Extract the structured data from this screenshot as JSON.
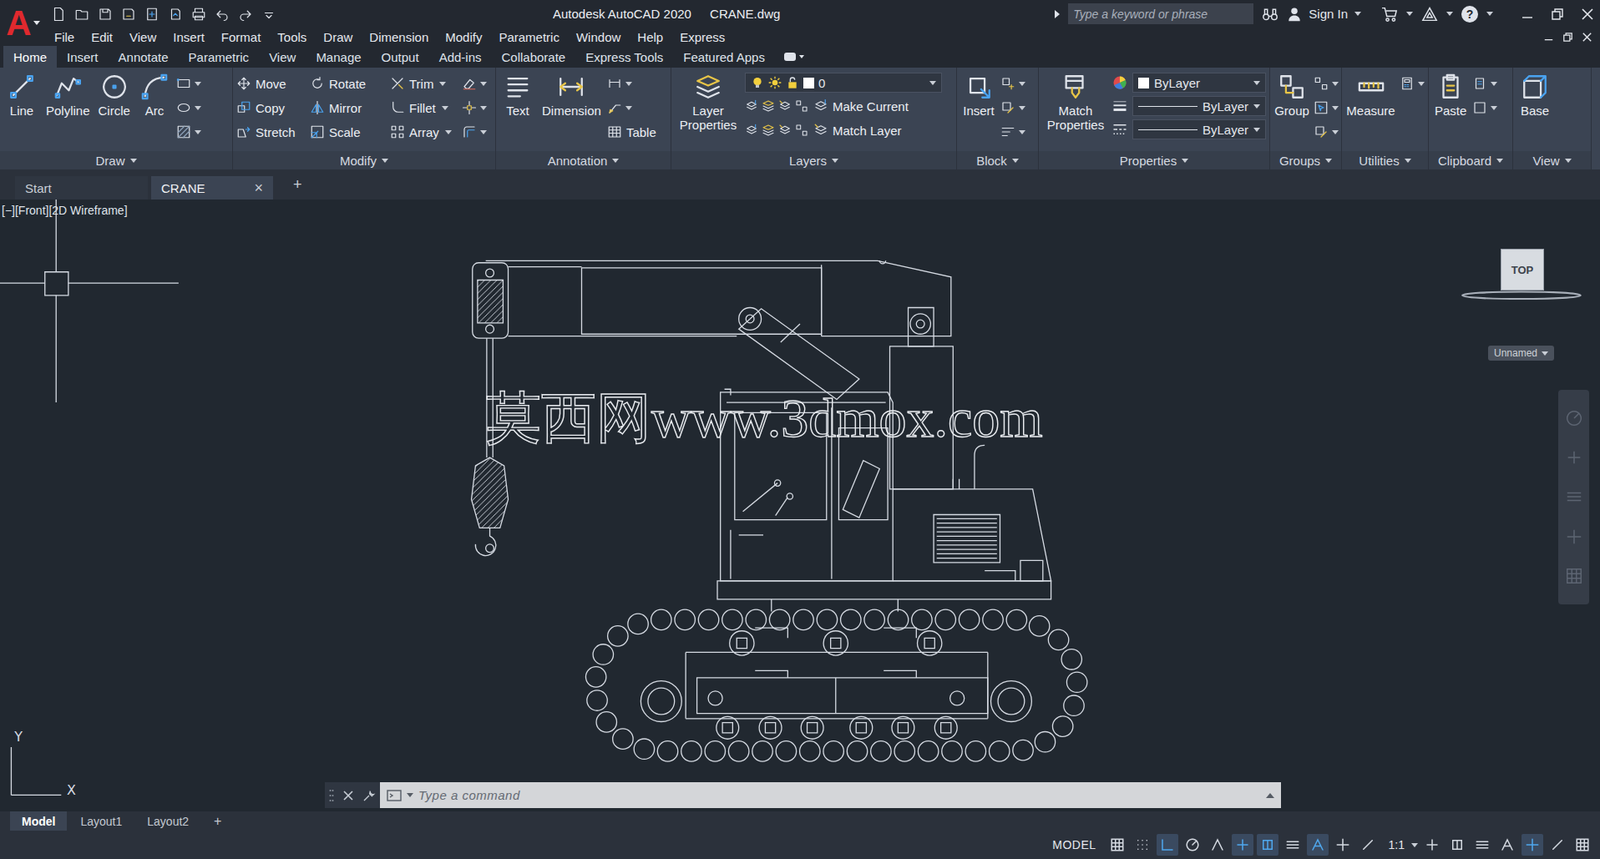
{
  "window": {
    "title": "Autodesk AutoCAD 2020",
    "file": "CRANE.dwg",
    "logo": "A"
  },
  "search": {
    "placeholder": "Type a keyword or phrase"
  },
  "account": {
    "label": "Sign In"
  },
  "help": "?",
  "menu": [
    "File",
    "Edit",
    "View",
    "Insert",
    "Format",
    "Tools",
    "Draw",
    "Dimension",
    "Modify",
    "Parametric",
    "Window",
    "Help",
    "Express"
  ],
  "ribbon_tabs": [
    {
      "label": "Home",
      "selected": true
    },
    {
      "label": "Insert",
      "selected": false
    },
    {
      "label": "Annotate",
      "selected": false
    },
    {
      "label": "Parametric",
      "selected": false
    },
    {
      "label": "View",
      "selected": false
    },
    {
      "label": "Manage",
      "selected": false
    },
    {
      "label": "Output",
      "selected": false
    },
    {
      "label": "Add-ins",
      "selected": false
    },
    {
      "label": "Collaborate",
      "selected": false
    },
    {
      "label": "Express Tools",
      "selected": false
    },
    {
      "label": "Featured Apps",
      "selected": false
    }
  ],
  "ribbon_panels": [
    {
      "title": "Draw",
      "large": [
        "Line",
        "Polyline",
        "Circle",
        "Arc"
      ],
      "small": []
    },
    {
      "title": "Modify",
      "large": [],
      "small": [
        "Move",
        "Rotate",
        "Trim",
        "Copy",
        "Mirror",
        "Fillet",
        "Stretch",
        "Scale",
        "Array"
      ]
    },
    {
      "title": "Annotation",
      "large": [
        "Text",
        "Dimension"
      ],
      "small": [
        "Table"
      ]
    },
    {
      "title": "Layers",
      "large": [
        "Layer Properties"
      ],
      "layer": "0",
      "small": [
        "Make Current",
        "Match Layer"
      ]
    },
    {
      "title": "Block",
      "large": [
        "Insert"
      ],
      "small": []
    },
    {
      "title": "Properties",
      "large": [
        "Match Properties"
      ],
      "dropdowns": [
        "ByLayer",
        "ByLayer",
        "ByLayer"
      ],
      "small": []
    },
    {
      "title": "Groups",
      "large": [
        "Group"
      ],
      "small": []
    },
    {
      "title": "Utilities",
      "large": [
        "Measure"
      ],
      "small": []
    },
    {
      "title": "Clipboard",
      "large": [
        "Paste"
      ],
      "small": []
    },
    {
      "title": "View",
      "large": [
        "Base"
      ],
      "small": []
    }
  ],
  "doc_tabs": [
    {
      "label": "Start",
      "selected": false,
      "closable": false
    },
    {
      "label": "CRANE",
      "selected": true,
      "closable": true
    }
  ],
  "doc_tab_close": "×",
  "doc_tab_add": "+",
  "viewport": {
    "label": "[−][Front][2D Wireframe]",
    "watermark": "莫西网www.3dmox.com",
    "viewcube": "TOP",
    "named_view": "Unnamed",
    "ucs_x": "X",
    "ucs_y": "Y"
  },
  "command": {
    "placeholder": "Type a command"
  },
  "layout_tabs": [
    {
      "label": "Model",
      "selected": true
    },
    {
      "label": "Layout1",
      "selected": false
    },
    {
      "label": "Layout2",
      "selected": false
    }
  ],
  "layout_add": "+",
  "status_bar": {
    "mode": "MODEL",
    "scale": "1:1",
    "toggles": [
      {
        "on": false
      },
      {
        "on": false
      },
      {
        "on": true
      },
      {
        "on": false
      },
      {
        "on": false
      },
      {
        "on": true
      },
      {
        "on": true
      },
      {
        "on": false
      },
      {
        "on": true
      },
      {
        "on": false
      },
      {
        "on": false
      }
    ],
    "tools": [
      {
        "on": false
      },
      {
        "on": false
      },
      {
        "on": false
      },
      {
        "on": false
      },
      {
        "on": true
      },
      {
        "on": false
      },
      {
        "on": false
      }
    ]
  }
}
